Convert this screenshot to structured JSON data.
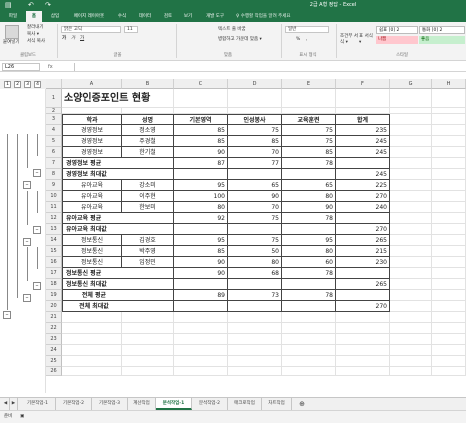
{
  "window": {
    "title": "2급 A형 정답 - Excel",
    "save_icon": "floppy-disk-icon",
    "undo_icon": "undo-icon",
    "redo_icon": "redo-icon"
  },
  "ribbon_tabs": [
    "파일",
    "홈",
    "삽입",
    "페이지 레이아웃",
    "수식",
    "데이터",
    "검토",
    "보기",
    "개발 도구"
  ],
  "tell_me": "♀ 수행할 작업을 알려 주세요",
  "ribbon": {
    "paste": "붙여넣기",
    "cut": "잘라내기",
    "copy": "복사 ▾",
    "format_painter": "서식 복사",
    "font_name": "맑은 고딕",
    "font_size": "11",
    "bold": "가",
    "italic": "가",
    "underline": "가",
    "wrap_text": "텍스트 줄 바꿈",
    "merge_center": "병합하고 가운데 맞춤 ▾",
    "number_format": "일반",
    "percent": "%",
    "comma": ",",
    "conditional_format": "조건부 서식 ▾",
    "table_format": "표 서식 ▾",
    "style_normal": "표준",
    "style_normal2": "쉼표 [0] 2",
    "style_currency": "통화 [0] 2",
    "style_bad": "나쁨",
    "style_good": "좋음",
    "groups": {
      "clipboard": "클립보드",
      "font": "글꼴",
      "alignment": "맞춤",
      "number": "표시 형식",
      "styles": "스타일"
    }
  },
  "formula_bar": {
    "cell_ref": "L26",
    "fx": "fx"
  },
  "outline_levels": [
    "1",
    "2",
    "3",
    "4"
  ],
  "columns": [
    "A",
    "B",
    "C",
    "D",
    "E",
    "F",
    "G",
    "H"
  ],
  "rows": [
    {
      "n": "1",
      "cells": [
        "소양인증포인트 현황",
        "",
        "",
        "",
        "",
        "",
        "",
        ""
      ]
    },
    {
      "n": "2",
      "cells": [
        "",
        "",
        "",
        "",
        "",
        "",
        "",
        ""
      ]
    },
    {
      "n": "3",
      "cells": [
        "학과",
        "성명",
        "기본영역",
        "인성봉사",
        "교육훈련",
        "합계",
        "",
        ""
      ]
    },
    {
      "n": "4",
      "cells": [
        "경영정보",
        "정소영",
        "85",
        "75",
        "75",
        "235",
        "",
        ""
      ]
    },
    {
      "n": "5",
      "cells": [
        "경영정보",
        "주경철",
        "85",
        "85",
        "75",
        "245",
        "",
        ""
      ]
    },
    {
      "n": "6",
      "cells": [
        "경영정보",
        "한기철",
        "90",
        "70",
        "85",
        "245",
        "",
        ""
      ]
    },
    {
      "n": "7",
      "cells": [
        "경영정보 평균",
        "",
        "87",
        "77",
        "78",
        "",
        "",
        ""
      ]
    },
    {
      "n": "8",
      "cells": [
        "경영정보 최대값",
        "",
        "",
        "",
        "",
        "245",
        "",
        ""
      ]
    },
    {
      "n": "9",
      "cells": [
        "유아교육",
        "강소미",
        "95",
        "65",
        "65",
        "225",
        "",
        ""
      ]
    },
    {
      "n": "10",
      "cells": [
        "유아교육",
        "이주현",
        "100",
        "90",
        "80",
        "270",
        "",
        ""
      ]
    },
    {
      "n": "11",
      "cells": [
        "유아교육",
        "한보미",
        "80",
        "70",
        "90",
        "240",
        "",
        ""
      ]
    },
    {
      "n": "12",
      "cells": [
        "유아교육 평균",
        "",
        "92",
        "75",
        "78",
        "",
        "",
        ""
      ]
    },
    {
      "n": "13",
      "cells": [
        "유아교육 최대값",
        "",
        "",
        "",
        "",
        "270",
        "",
        ""
      ]
    },
    {
      "n": "14",
      "cells": [
        "정보통신",
        "김경호",
        "95",
        "75",
        "95",
        "265",
        "",
        ""
      ]
    },
    {
      "n": "15",
      "cells": [
        "정보통신",
        "박주영",
        "85",
        "50",
        "80",
        "215",
        "",
        ""
      ]
    },
    {
      "n": "16",
      "cells": [
        "정보통신",
        "임정민",
        "90",
        "80",
        "60",
        "230",
        "",
        ""
      ]
    },
    {
      "n": "17",
      "cells": [
        "정보통신 평균",
        "",
        "90",
        "68",
        "78",
        "",
        "",
        ""
      ]
    },
    {
      "n": "18",
      "cells": [
        "정보통신 최대값",
        "",
        "",
        "",
        "",
        "265",
        "",
        ""
      ]
    },
    {
      "n": "19",
      "cells": [
        "전체 평균",
        "",
        "89",
        "73",
        "78",
        "",
        "",
        ""
      ]
    },
    {
      "n": "20",
      "cells": [
        "전체 최대값",
        "",
        "",
        "",
        "",
        "270",
        "",
        ""
      ]
    },
    {
      "n": "21",
      "cells": [
        "",
        "",
        "",
        "",
        "",
        "",
        "",
        ""
      ]
    },
    {
      "n": "22",
      "cells": [
        "",
        "",
        "",
        "",
        "",
        "",
        "",
        ""
      ]
    },
    {
      "n": "23",
      "cells": [
        "",
        "",
        "",
        "",
        "",
        "",
        "",
        ""
      ]
    },
    {
      "n": "24",
      "cells": [
        "",
        "",
        "",
        "",
        "",
        "",
        "",
        ""
      ]
    },
    {
      "n": "25",
      "cells": [
        "",
        "",
        "",
        "",
        "",
        "",
        "",
        ""
      ]
    },
    {
      "n": "26",
      "cells": [
        "",
        "",
        "",
        "",
        "",
        "",
        "",
        ""
      ]
    }
  ],
  "outline_buttons": [
    "–",
    "–",
    "–",
    "–",
    "–",
    "–",
    "–"
  ],
  "sheet_tabs": [
    "기본작업-1",
    "기본작업-2",
    "기본작업-3",
    "계산작업",
    "분석작업-1",
    "분석작업-2",
    "매크로작업",
    "차트작업"
  ],
  "active_sheet_index": 4,
  "add_sheet": "⊕",
  "status": {
    "ready": "준비",
    "mode_icon": "macro-record-icon"
  },
  "colors": {
    "excel_green": "#217346"
  }
}
